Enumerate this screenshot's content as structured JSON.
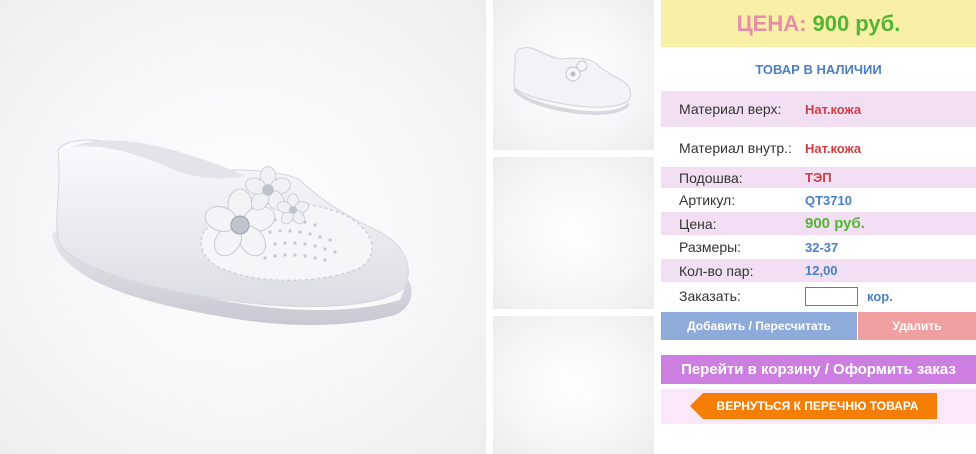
{
  "price_banner": {
    "label": "ЦЕНА:",
    "value": "900 руб."
  },
  "availability": "ТОВАР В НАЛИЧИИ",
  "specs": {
    "upper_material": {
      "label": "Материал верх:",
      "value": "Нат.кожа"
    },
    "inner_material": {
      "label": "Материал внутр.:",
      "value": "Нат.кожа"
    },
    "sole": {
      "label": "Подошва:",
      "value": "ТЭП"
    },
    "article": {
      "label": "Артикул:",
      "value": "QT3710"
    },
    "price": {
      "label": "Цена:",
      "value": "900 руб."
    },
    "sizes": {
      "label": "Размеры:",
      "value": "32-37"
    },
    "pairs": {
      "label": "Кол-во пар:",
      "value": "12,00"
    }
  },
  "order": {
    "label": "Заказать:",
    "value": "",
    "unit": "кор."
  },
  "buttons": {
    "add": "Добавить / Пересчитать",
    "delete": "Удалить",
    "cart": "Перейти в корзину / Оформить заказ",
    "back": "ВЕРНУТЬСЯ К ПЕРЕЧНЮ ТОВАРА"
  },
  "colors": {
    "accent_blue": "#4a7fc1",
    "price_green": "#53b534",
    "label_pink": "#e58ea6",
    "banner_yellow": "#f8f0a6",
    "row_pink": "#f3dff3",
    "back_orange": "#f57e07"
  },
  "icons": {
    "back_button": "left-arrow-shape"
  }
}
